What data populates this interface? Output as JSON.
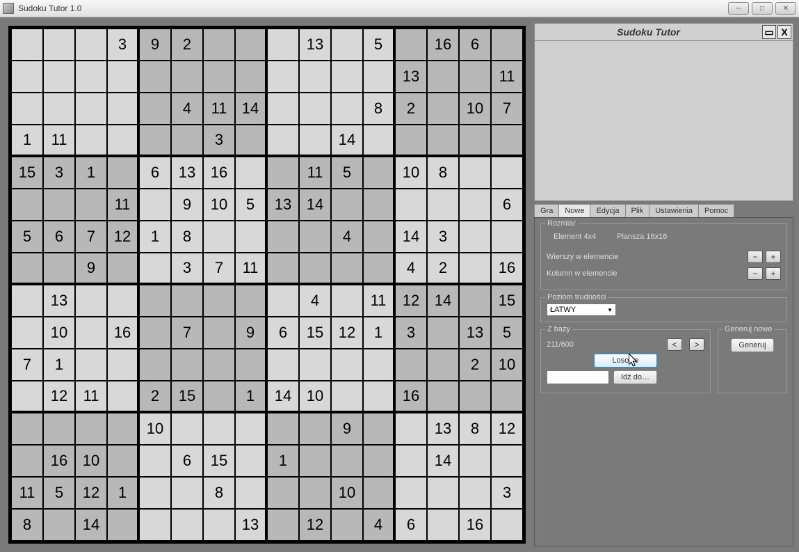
{
  "window": {
    "title": "Sudoku Tutor 1.0"
  },
  "panel": {
    "title": "Sudoku Tutor"
  },
  "tabs": [
    "Gra",
    "Nowe",
    "Edycja",
    "Plik",
    "Ustawienia",
    "Pomoc"
  ],
  "activeTab": 1,
  "rozmiar": {
    "legend": "Rozmiar",
    "elementLabel": "Element 4x4",
    "boardLabel": "Plansza 16x16",
    "rowsLabel": "Wierszy w elemencie",
    "colsLabel": "Kolumn w elemencie",
    "minus": "−",
    "plus": "+"
  },
  "difficulty": {
    "legend": "Poziom trudności",
    "value": "ŁATWY"
  },
  "zbazy": {
    "legend": "Z bazy",
    "counter": "211/600",
    "prev": "<",
    "next": ">",
    "random": "Losowe",
    "goto": "Idź do…"
  },
  "generuj": {
    "legend": "Generuj nowe",
    "button": "Generuj"
  },
  "grid": [
    [
      "",
      "",
      "",
      "3",
      "9",
      "2",
      "",
      "",
      "",
      "13",
      "",
      "5",
      "",
      "16",
      "6",
      ""
    ],
    [
      "",
      "",
      "",
      "",
      "",
      "",
      "",
      "",
      "",
      "",
      "",
      "",
      "13",
      "",
      "",
      "11"
    ],
    [
      "",
      "",
      "",
      "",
      "",
      "4",
      "11",
      "14",
      "",
      "",
      "",
      "8",
      "2",
      "",
      "10",
      "7"
    ],
    [
      "1",
      "11",
      "",
      "",
      "",
      "",
      "3",
      "",
      "",
      "",
      "14",
      "",
      "",
      "",
      "",
      ""
    ],
    [
      "15",
      "3",
      "1",
      "",
      "6",
      "13",
      "16",
      "",
      "",
      "11",
      "5",
      "",
      "10",
      "8",
      "",
      ""
    ],
    [
      "",
      "",
      "",
      "11",
      "",
      "9",
      "10",
      "5",
      "13",
      "14",
      "",
      "",
      "",
      "",
      "",
      "6"
    ],
    [
      "5",
      "6",
      "7",
      "12",
      "1",
      "8",
      "",
      "",
      "",
      "",
      "4",
      "",
      "14",
      "3",
      "",
      ""
    ],
    [
      "",
      "",
      "9",
      "",
      "",
      "3",
      "7",
      "11",
      "",
      "",
      "",
      "",
      "4",
      "2",
      "",
      "16"
    ],
    [
      "",
      "13",
      "",
      "",
      "",
      "",
      "",
      "",
      "",
      "4",
      "",
      "11",
      "12",
      "14",
      "",
      "15"
    ],
    [
      "",
      "10",
      "",
      "16",
      "",
      "7",
      "",
      "9",
      "6",
      "15",
      "12",
      "1",
      "3",
      "",
      "13",
      "5"
    ],
    [
      "7",
      "1",
      "",
      "",
      "",
      "",
      "",
      "",
      "",
      "",
      "",
      "",
      "",
      "",
      "2",
      "10"
    ],
    [
      "",
      "12",
      "11",
      "",
      "2",
      "15",
      "",
      "1",
      "14",
      "10",
      "",
      "",
      "16",
      "",
      "",
      ""
    ],
    [
      "",
      "",
      "",
      "",
      "10",
      "",
      "",
      "",
      "",
      "",
      "9",
      "",
      "",
      "13",
      "8",
      "12"
    ],
    [
      "",
      "16",
      "10",
      "",
      "",
      "6",
      "15",
      "",
      "1",
      "",
      "",
      "",
      "",
      "14",
      "",
      ""
    ],
    [
      "11",
      "5",
      "12",
      "1",
      "",
      "",
      "8",
      "",
      "",
      "",
      "10",
      "",
      "",
      "",
      "",
      "3"
    ],
    [
      "8",
      "",
      "14",
      "",
      "",
      "",
      "",
      "13",
      "",
      "12",
      "",
      "4",
      "6",
      "",
      "16",
      ""
    ]
  ]
}
